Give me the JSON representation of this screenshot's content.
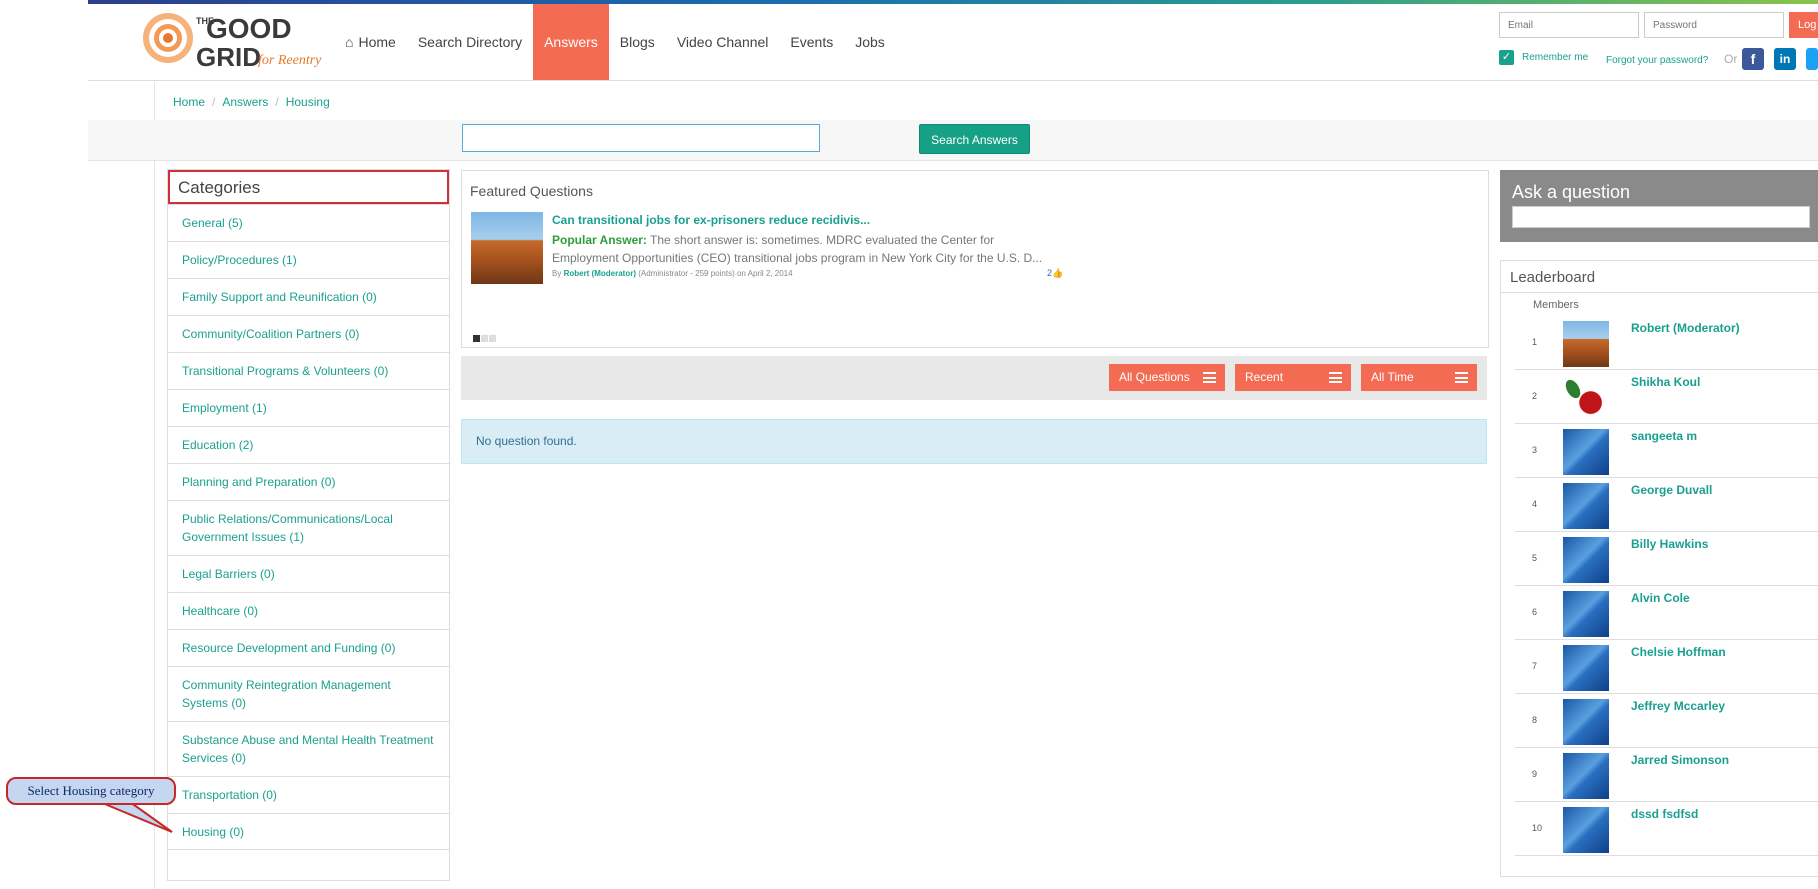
{
  "brand": {
    "logo_title": "THE GOOD GRID",
    "logo_subtitle": "for Reentry"
  },
  "nav": {
    "items": [
      "Home",
      "Search Directory",
      "Answers",
      "Blogs",
      "Video Channel",
      "Events",
      "Jobs"
    ],
    "active": "Answers"
  },
  "login": {
    "email_placeholder": "Email",
    "password_placeholder": "Password",
    "button": "Log",
    "remember": "Remember me",
    "forgot": "Forgot your password?",
    "or": "Or"
  },
  "breadcrumb": [
    "Home",
    "Answers",
    "Housing"
  ],
  "search": {
    "button": "Search Answers",
    "value": ""
  },
  "categories": {
    "title": "Categories",
    "items": [
      "General (5)",
      "Policy/Procedures (1)",
      "Family Support and Reunification (0)",
      "Community/Coalition Partners (0)",
      "Transitional Programs & Volunteers (0)",
      "Employment (1)",
      "Education (2)",
      "Planning and Preparation (0)",
      "Public Relations/Communications/Local Government Issues (1)",
      "Legal Barriers (0)",
      "Healthcare (0)",
      "Resource Development and Funding (0)",
      "Community Reintegration Management Systems (0)",
      "Substance Abuse and Mental Health Treatment Services (0)",
      "Transportation (0)",
      "Housing (0)"
    ]
  },
  "featured": {
    "title": "Featured Questions",
    "question": "Can transitional jobs for ex-prisoners reduce recidivis...",
    "answer_label": "Popular Answer:",
    "answer_text": " The short answer is: sometimes. MDRC evaluated the Center for Employment Opportunities (CEO) transitional jobs program in New York City for the U.S. D...",
    "meta_by": "By ",
    "meta_author": "Robert (Moderator)",
    "meta_rest": "(Administrator - 259 points)  on April 2, 2014",
    "votes": "2"
  },
  "filters": [
    "All Questions",
    "Recent",
    "All Time"
  ],
  "empty_message": "No question found.",
  "ask": {
    "title": "Ask a question",
    "placeholder": ""
  },
  "leaderboard": {
    "title": "Leaderboard",
    "members_label": "Members",
    "rows": [
      {
        "rank": "1",
        "name": "Robert (Moderator)",
        "avatar": "landscape"
      },
      {
        "rank": "2",
        "name": "Shikha Koul",
        "avatar": "rose"
      },
      {
        "rank": "3",
        "name": "sangeeta m",
        "avatar": "default"
      },
      {
        "rank": "4",
        "name": "George Duvall",
        "avatar": "default"
      },
      {
        "rank": "5",
        "name": "Billy Hawkins",
        "avatar": "default"
      },
      {
        "rank": "6",
        "name": "Alvin Cole",
        "avatar": "default"
      },
      {
        "rank": "7",
        "name": "Chelsie Hoffman",
        "avatar": "default"
      },
      {
        "rank": "8",
        "name": "Jeffrey Mccarley",
        "avatar": "default"
      },
      {
        "rank": "9",
        "name": "Jarred Simonson",
        "avatar": "default"
      },
      {
        "rank": "10",
        "name": "dssd fsdfsd",
        "avatar": "default"
      }
    ]
  },
  "callout": "Select Housing category",
  "colors": {
    "accent": "#f36b53",
    "link": "#1aa08f",
    "highlight": "#d32f3a"
  }
}
